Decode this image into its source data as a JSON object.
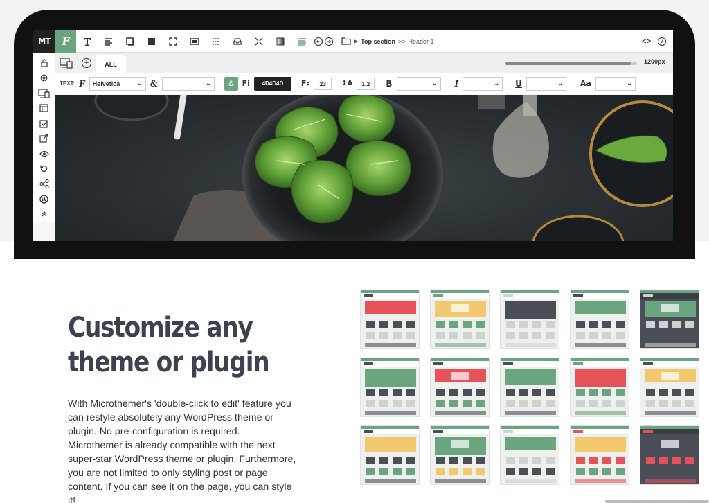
{
  "toolbar": {
    "logo": "MT",
    "font_icon": "F",
    "breadcrumb_section": "Top section",
    "breadcrumb_sep": ">>",
    "breadcrumb_item": "Header 1",
    "code_label": "<>",
    "help_label": "?"
  },
  "tabs": {
    "add_label": "+",
    "all_label": "ALL",
    "width_value": "1200px",
    "slider_fraction": 0.95
  },
  "text_props": {
    "label": "TEXT:",
    "font_family": "Helvetica",
    "color_hex": "4D4D4D",
    "font_size": "23",
    "line_height": "1.2",
    "bold_label": "B",
    "italic_label": "I",
    "underline_label": "U",
    "case_label": "Aa"
  },
  "content": {
    "headline_line1": "Customize any",
    "headline_line2": "theme or plugin",
    "body": "With Microthemer's 'double-click to edit' feature you can restyle absolutely any WordPress theme or plugin. No pre-configuration is required. Microthemer is already compatible with the next super-star WordPress theme or plugin. Furthermore, you are not limited to only styling post or page content. If you can see it on the page, you can style it!"
  },
  "colors": {
    "accent": "#6aa57f",
    "headline": "#3b4350",
    "red": "#e5525a",
    "yellow": "#f2c86e",
    "dark": "#4a4f57"
  },
  "icons": [
    "lock-icon",
    "gear-icon",
    "responsive-icon",
    "layout-icon",
    "edit-icon",
    "export-icon",
    "eye-icon",
    "history-icon",
    "share-icon",
    "wordpress-icon",
    "collapse-icon"
  ]
}
